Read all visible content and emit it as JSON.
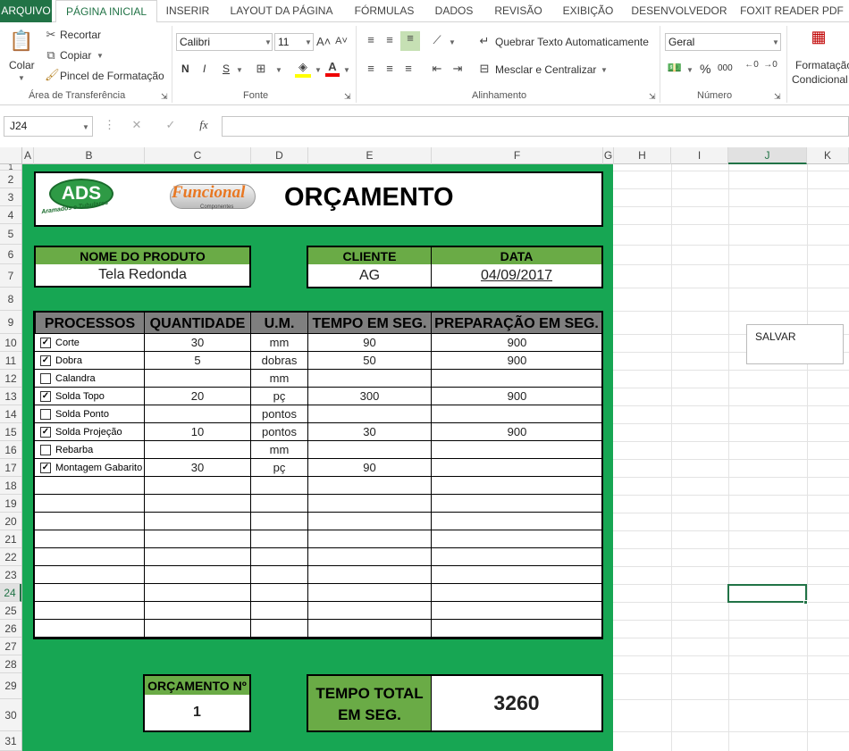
{
  "tabs": [
    "ARQUIVO",
    "PÁGINA INICIAL",
    "INSERIR",
    "LAYOUT DA PÁGINA",
    "FÓRMULAS",
    "DADOS",
    "REVISÃO",
    "EXIBIÇÃO",
    "DESENVOLVEDOR",
    "FOXIT READER PDF"
  ],
  "ribbon": {
    "paste": "Colar",
    "cut": "Recortar",
    "copy": "Copiar",
    "format_painter": "Pincel de Formatação",
    "clipboard_group": "Área de Transferência",
    "font_name": "Calibri",
    "font_size": "11",
    "bold": "N",
    "italic": "I",
    "underline": "S",
    "font_group": "Fonte",
    "wrap_text": "Quebrar Texto Automaticamente",
    "merge_center": "Mesclar e Centralizar",
    "align_group": "Alinhamento",
    "number_format": "Geral",
    "percent": "%",
    "thousands": "000",
    "number_group": "Número",
    "cond_format_1": "Formatação",
    "cond_format_2": "Condicional"
  },
  "formula_bar": {
    "name_box": "J24",
    "fx": "fx",
    "value": ""
  },
  "columns": [
    "A",
    "B",
    "C",
    "D",
    "E",
    "F",
    "G",
    "H",
    "I",
    "J",
    "K"
  ],
  "rows": [
    "1",
    "2",
    "3",
    "4",
    "5",
    "6",
    "7",
    "8",
    "9",
    "10",
    "11",
    "12",
    "13",
    "14",
    "15",
    "16",
    "17",
    "18",
    "19",
    "20",
    "21",
    "22",
    "23",
    "24",
    "25",
    "26",
    "27",
    "28",
    "29",
    "30",
    "31"
  ],
  "sheet": {
    "logo_ads": "ADS",
    "logo_ads_sub": "Aramados e Tubulares",
    "logo_func": "Funcional",
    "logo_func_sub": "Componentes",
    "title": "ORÇAMENTO",
    "product_label": "NOME DO PRODUTO",
    "product_value": "Tela Redonda",
    "client_label": "CLIENTE",
    "client_value": "AG",
    "date_label": "DATA",
    "date_value": "04/09/2017",
    "headers": [
      "PROCESSOS",
      "QUANTIDADE",
      "U.M.",
      "TEMPO EM SEG.",
      "PREPARAÇÃO EM SEG."
    ],
    "processes": [
      {
        "checked": true,
        "name": "Corte",
        "qty": "30",
        "unit": "mm",
        "time": "90",
        "prep": "900"
      },
      {
        "checked": true,
        "name": "Dobra",
        "qty": "5",
        "unit": "dobras",
        "time": "50",
        "prep": "900"
      },
      {
        "checked": false,
        "name": "Calandra",
        "qty": "",
        "unit": "mm",
        "time": "",
        "prep": ""
      },
      {
        "checked": true,
        "name": "Solda Topo",
        "qty": "20",
        "unit": "pç",
        "time": "300",
        "prep": "900"
      },
      {
        "checked": false,
        "name": "Solda Ponto",
        "qty": "",
        "unit": "pontos",
        "time": "",
        "prep": ""
      },
      {
        "checked": true,
        "name": "Solda Projeção",
        "qty": "10",
        "unit": "pontos",
        "time": "30",
        "prep": "900"
      },
      {
        "checked": false,
        "name": "Rebarba",
        "qty": "",
        "unit": "mm",
        "time": "",
        "prep": ""
      },
      {
        "checked": true,
        "name": "Montagem Gabarito",
        "qty": "30",
        "unit": "pç",
        "time": "90",
        "prep": ""
      }
    ],
    "budget_label": "ORÇAMENTO Nº",
    "budget_value": "1",
    "total_label_1": "TEMPO TOTAL",
    "total_label_2": "EM SEG.",
    "total_value": "3260",
    "save_button": "SALVAR"
  },
  "colors": {
    "excel_green": "#217346",
    "sheet_green": "#17a653",
    "header_green": "#6aab46",
    "header_gray": "#7f7f7f"
  }
}
